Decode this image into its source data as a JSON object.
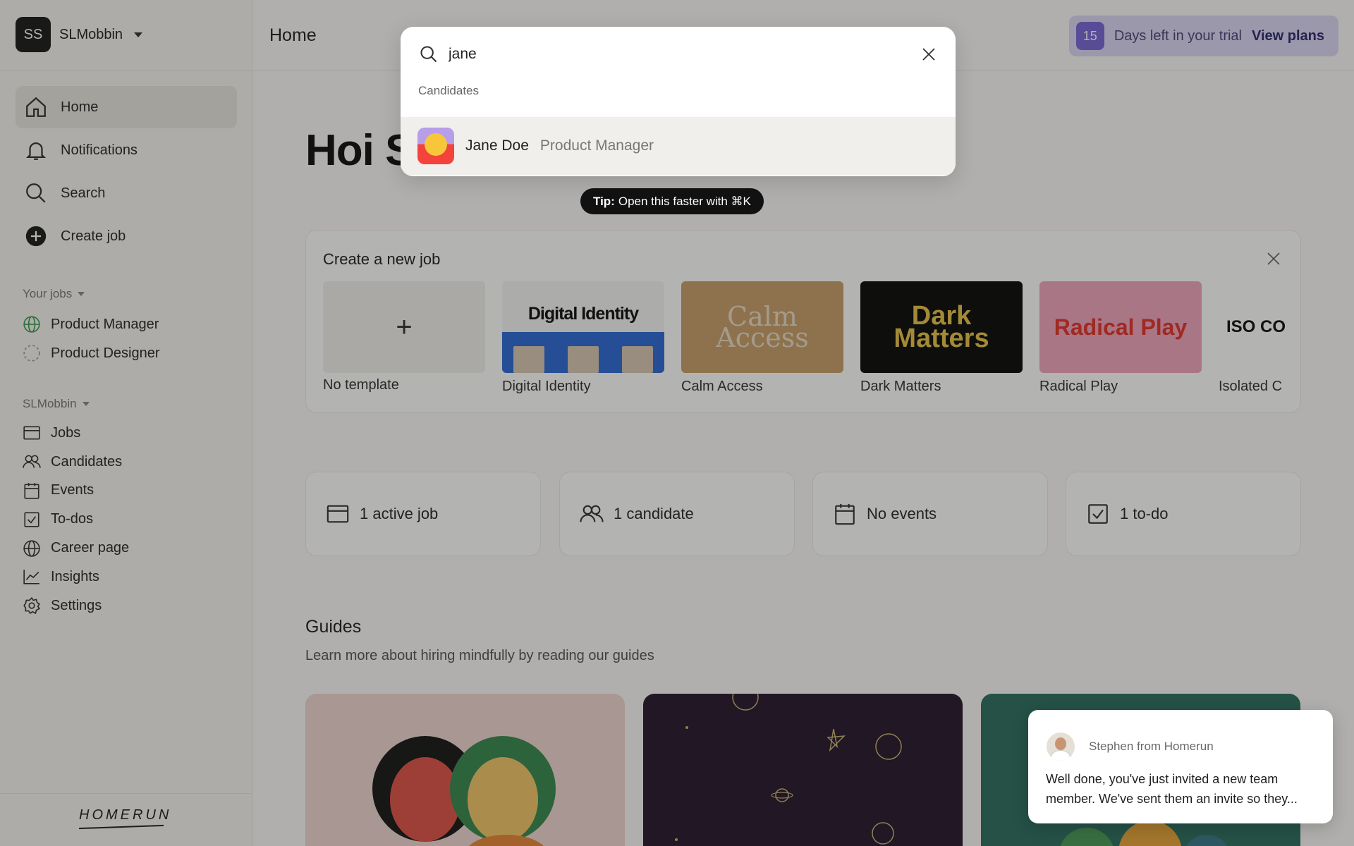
{
  "workspace": {
    "initials": "SS",
    "name": "SLMobbin"
  },
  "nav": [
    {
      "label": "Home",
      "icon": "home-icon",
      "active": true
    },
    {
      "label": "Notifications",
      "icon": "bell-icon"
    },
    {
      "label": "Search",
      "icon": "search-icon"
    },
    {
      "label": "Create job",
      "icon": "plus-circle-icon"
    }
  ],
  "your_jobs": {
    "label": "Your jobs",
    "items": [
      {
        "label": "Product Manager",
        "icon": "globe-icon"
      },
      {
        "label": "Product Designer",
        "icon": "dashed-circle-icon"
      }
    ]
  },
  "workspace_section": {
    "label": "SLMobbin",
    "items": [
      {
        "label": "Jobs",
        "icon": "briefcase-icon"
      },
      {
        "label": "Candidates",
        "icon": "users-icon"
      },
      {
        "label": "Events",
        "icon": "calendar-icon"
      },
      {
        "label": "To-dos",
        "icon": "checkbox-icon"
      },
      {
        "label": "Career page",
        "icon": "globe-icon"
      },
      {
        "label": "Insights",
        "icon": "chart-icon"
      },
      {
        "label": "Settings",
        "icon": "gear-icon"
      }
    ]
  },
  "brand_logo": "HOMERUN",
  "header": {
    "title": "Home"
  },
  "trial": {
    "days": "15",
    "text": "Days left in your trial",
    "link": "View plans"
  },
  "greeting": "Hoi S",
  "create_job": {
    "title": "Create a new job",
    "templates": [
      {
        "label": "No template",
        "thumb": "+"
      },
      {
        "label": "Digital Identity",
        "thumb": "Digital Identity"
      },
      {
        "label": "Calm Access",
        "thumb": "Calm Access"
      },
      {
        "label": "Dark Matters",
        "thumb": "Dark Matters"
      },
      {
        "label": "Radical Play",
        "thumb": "Radical Play"
      },
      {
        "label": "Isolated C",
        "thumb": "ISO CO"
      }
    ]
  },
  "stats": [
    {
      "label": "1 active job",
      "icon": "briefcase-icon"
    },
    {
      "label": "1 candidate",
      "icon": "users-icon"
    },
    {
      "label": "No events",
      "icon": "calendar-icon"
    },
    {
      "label": "1 to-do",
      "icon": "checkbox-icon"
    }
  ],
  "guides": {
    "title": "Guides",
    "subtitle": "Learn more about hiring mindfully by reading our guides"
  },
  "search_palette": {
    "query": "jane",
    "group_label": "Candidates",
    "result": {
      "name": "Jane Doe",
      "role": "Product Manager"
    }
  },
  "tip": {
    "bold": "Tip:",
    "text": "Open this faster with ⌘K"
  },
  "chat": {
    "from": "Stephen from Homerun",
    "message": "Well done, you've just invited a new team member. We've sent them an invite so they..."
  },
  "colors": {
    "accent": "#7a68d8",
    "trial_bg": "#dcd7f6",
    "active_nav": "#e8e6e1"
  }
}
